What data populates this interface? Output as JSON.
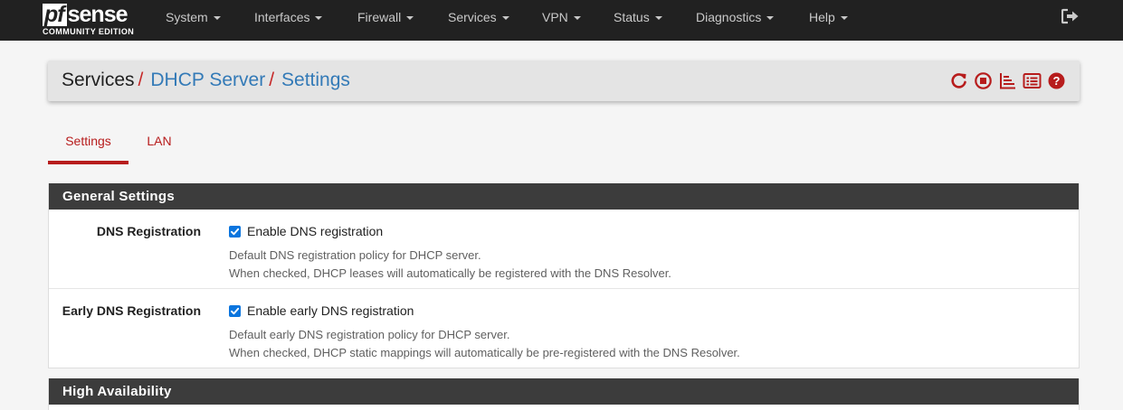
{
  "logo": {
    "pf": "pf",
    "sense": "sense",
    "edition": "COMMUNITY EDITION"
  },
  "nav": {
    "items": [
      "System",
      "Interfaces",
      "Firewall",
      "Services",
      "VPN",
      "Status",
      "Diagnostics",
      "Help"
    ]
  },
  "breadcrumb": {
    "root": "Services",
    "separator": "/",
    "level2": "DHCP Server",
    "level3": "Settings"
  },
  "header_icons": [
    "restart-icon",
    "stop-icon",
    "logs-icon",
    "list-icon",
    "help-icon"
  ],
  "tabs": [
    {
      "label": "Settings",
      "active": true
    },
    {
      "label": "LAN",
      "active": false
    }
  ],
  "general": {
    "title": "General Settings",
    "rows": [
      {
        "label": "DNS Registration",
        "checkbox_label": "Enable DNS registration",
        "checked": true,
        "help1": "Default DNS registration policy for DHCP server.",
        "help2": "When checked, DHCP leases will automatically be registered with the DNS Resolver."
      },
      {
        "label": "Early DNS Registration",
        "checkbox_label": "Enable early DNS registration",
        "checked": true,
        "help1": "Default early DNS registration policy for DHCP server.",
        "help2": "When checked, DHCP static mappings will automatically be pre-registered with the DNS Resolver."
      }
    ]
  },
  "ha": {
    "title": "High Availability"
  },
  "colors": {
    "navbar": "#212121",
    "accent_red": "#b71c1c",
    "link_blue": "#337ab7",
    "panel_heading": "#3c3c3c",
    "checkbox": "#0b75de"
  }
}
